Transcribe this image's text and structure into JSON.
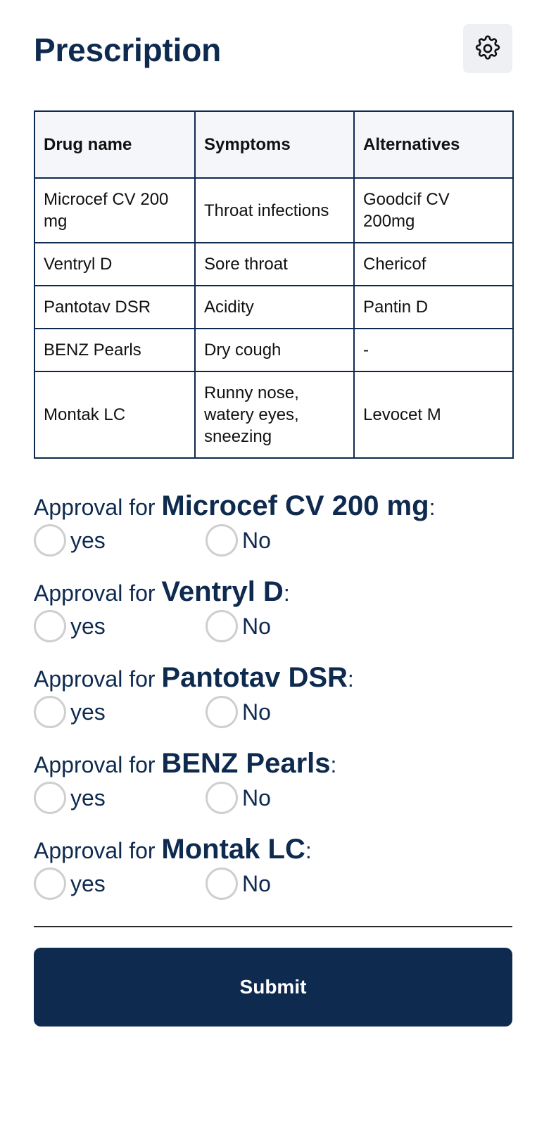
{
  "header": {
    "title": "Prescription",
    "settings_icon": "gear-icon"
  },
  "table": {
    "headers": [
      "Drug name",
      "Symptoms",
      "Alternatives"
    ],
    "rows": [
      [
        "Microcef CV 200 mg",
        "Throat infections",
        "Goodcif CV 200mg"
      ],
      [
        "Ventryl D",
        "Sore throat",
        "Chericof"
      ],
      [
        "Pantotav DSR",
        "Acidity",
        "Pantin D"
      ],
      [
        "BENZ Pearls",
        "Dry cough",
        "-"
      ],
      [
        "Montak LC",
        "Runny nose, watery eyes, sneezing",
        "Levocet M"
      ]
    ]
  },
  "approvals": {
    "prefix": "Approval for ",
    "suffix": ":",
    "yes_label": "yes",
    "no_label": "No",
    "items": [
      {
        "drug": "Microcef CV 200 mg"
      },
      {
        "drug": "Ventryl D"
      },
      {
        "drug": "Pantotav DSR"
      },
      {
        "drug": "BENZ Pearls"
      },
      {
        "drug": "Montak LC"
      }
    ]
  },
  "submit": {
    "label": "Submit"
  },
  "colors": {
    "primary": "#0e2a4f",
    "header_bg": "#f5f6fa",
    "radio_border": "#cfcfcf",
    "settings_bg": "#eef0f3"
  }
}
